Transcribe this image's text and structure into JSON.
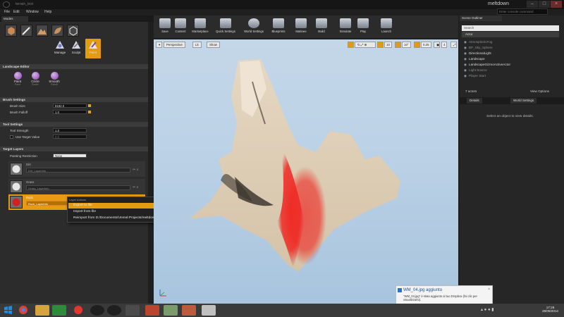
{
  "window": {
    "title": "terrain_test",
    "app_name": "meltdown"
  },
  "menu": [
    "File",
    "Edit",
    "Window",
    "Help"
  ],
  "console_search": {
    "placeholder": "Enter console command"
  },
  "modes": {
    "tab": "Modes",
    "sub": [
      "Manage",
      "Sculpt",
      "Paint"
    ]
  },
  "landscape": {
    "header": "Landscape Editor",
    "tools": [
      {
        "label": "Paint",
        "sub": "Paint"
      },
      {
        "label": "Circle",
        "sub": "Brush"
      },
      {
        "label": "Smooth",
        "sub": "Falloff"
      }
    ]
  },
  "brush_settings": {
    "header": "Brush Settings",
    "size_label": "Brush Size",
    "size_value": "8192.0",
    "falloff_label": "Brush Falloff",
    "falloff_value": "1.0"
  },
  "tool_settings": {
    "header": "Tool Settings",
    "strength_label": "Tool Strength",
    "strength_value": "1.0",
    "target_label": "Use Target Value",
    "target_value": "0.0"
  },
  "target_layers": {
    "header": "Target Layers",
    "restriction_label": "Painting Restriction",
    "restriction_value": "None",
    "layers": [
      {
        "name": "Dirt",
        "info": "Dirt_LayerInfo"
      },
      {
        "name": "Grass",
        "info": "Grass_LayerInfo"
      },
      {
        "name": "Rock",
        "info": "Rock_LayerInfo"
      }
    ]
  },
  "context_menu": {
    "title": "Layer Actions",
    "items": [
      "Export to file",
      "Import from file",
      "Reimport from D:/Documents/Unreal Projects/meltdown/meltdown_buildfile/Assets/tuts/mask.png"
    ]
  },
  "toolbar": [
    "Save",
    "Content",
    "Marketplace",
    "Quick Settings",
    "World Settings",
    "Blueprints",
    "Matinee",
    "Build",
    "Simulate",
    "Play",
    "Launch"
  ],
  "viewport": {
    "perspective": "Perspective",
    "lit": "Lit",
    "show": "Show",
    "grid": "10",
    "angle": "10°",
    "scale": "0.25",
    "camera": "4"
  },
  "scene_outliner": {
    "tab": "Scene Outliner",
    "search": "Search",
    "column": "Actor",
    "items": [
      "AtmosphericFog",
      "BP_Sky_Sphere",
      "DirectionalLight",
      "Landscape",
      "LandscapeGizmoActiveActor",
      "Light Source",
      "Player Start"
    ],
    "count": "7 actors",
    "view_options": "View Options"
  },
  "details": {
    "tab_details": "Details",
    "tab_world": "World Settings",
    "message": "Select an object to view details."
  },
  "notification": {
    "title": "WM_04.jpg aggiunto",
    "text": "\"WM_04.jpg\" è stato aggiunto al tuo Dropbox (fai clic per visualizzarlo)."
  },
  "clock": {
    "time": "17:28",
    "date": "28/05/2014"
  },
  "colors": {
    "accent": "#e39b12",
    "panel": "#2c2c2c",
    "red_paint": "#ee2a24"
  }
}
